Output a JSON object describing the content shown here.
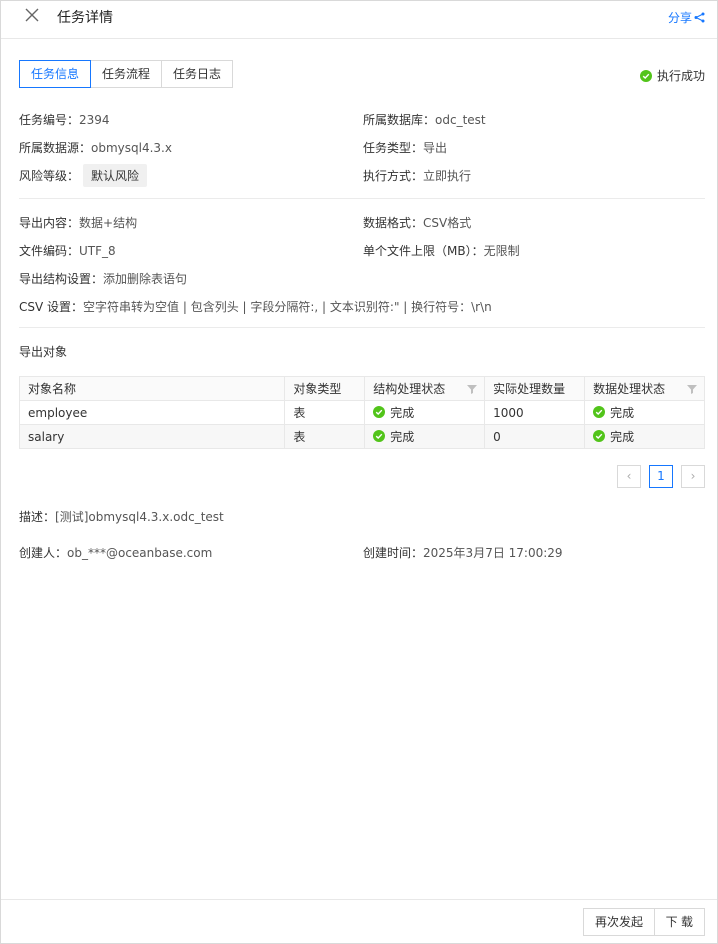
{
  "header": {
    "title": "任务详情",
    "share_label": "分享"
  },
  "tabs": [
    {
      "label": "任务信息",
      "active": true
    },
    {
      "label": "任务流程",
      "active": false
    },
    {
      "label": "任务日志",
      "active": false
    }
  ],
  "status": {
    "label": "执行成功",
    "color": "#52c41a"
  },
  "info": {
    "task_id": {
      "label": "任务编号：",
      "value": "2394"
    },
    "database": {
      "label": "所属数据库：",
      "value": "odc_test"
    },
    "datasource": {
      "label": "所属数据源：",
      "value": "obmysql4.3.x"
    },
    "task_type": {
      "label": "任务类型：",
      "value": "导出"
    },
    "risk_level": {
      "label": "风险等级：",
      "value": "默认风险"
    },
    "exec_mode": {
      "label": "执行方式：",
      "value": "立即执行"
    }
  },
  "export": {
    "content": {
      "label": "导出内容：",
      "value": "数据+结构"
    },
    "format": {
      "label": "数据格式：",
      "value": "CSV格式"
    },
    "encoding": {
      "label": "文件编码：",
      "value": "UTF_8"
    },
    "size_limit": {
      "label": "单个文件上限（MB）：",
      "value": "无限制"
    },
    "structure": {
      "label": "导出结构设置：",
      "value": "添加删除表语句"
    },
    "csv": {
      "label": "CSV 设置：",
      "value": "空字符串转为空值 | 包含列头 | 字段分隔符:, | 文本识别符:\" | 换行符号：\\r\\n"
    }
  },
  "objects": {
    "section_title": "导出对象",
    "columns": [
      "对象名称",
      "对象类型",
      "结构处理状态",
      "实际处理数量",
      "数据处理状态"
    ],
    "rows": [
      {
        "name": "employee",
        "type": "表",
        "struct_status": "完成",
        "count": "1000",
        "data_status": "完成"
      },
      {
        "name": "salary",
        "type": "表",
        "struct_status": "完成",
        "count": "0",
        "data_status": "完成"
      }
    ]
  },
  "pagination": {
    "current": "1",
    "prev": "‹",
    "next": "›"
  },
  "description": {
    "label": "描述：",
    "value": "[测试]obmysql4.3.x.odc_test"
  },
  "creator": {
    "label": "创建人：",
    "value": "ob_***@oceanbase.com"
  },
  "created_time": {
    "label": "创建时间：",
    "value": "2025年3月7日 17:00:29"
  },
  "footer": {
    "retry_label": "再次发起",
    "download_label": "下 载"
  },
  "colors": {
    "accent": "#1677ff",
    "success": "#52c41a"
  }
}
